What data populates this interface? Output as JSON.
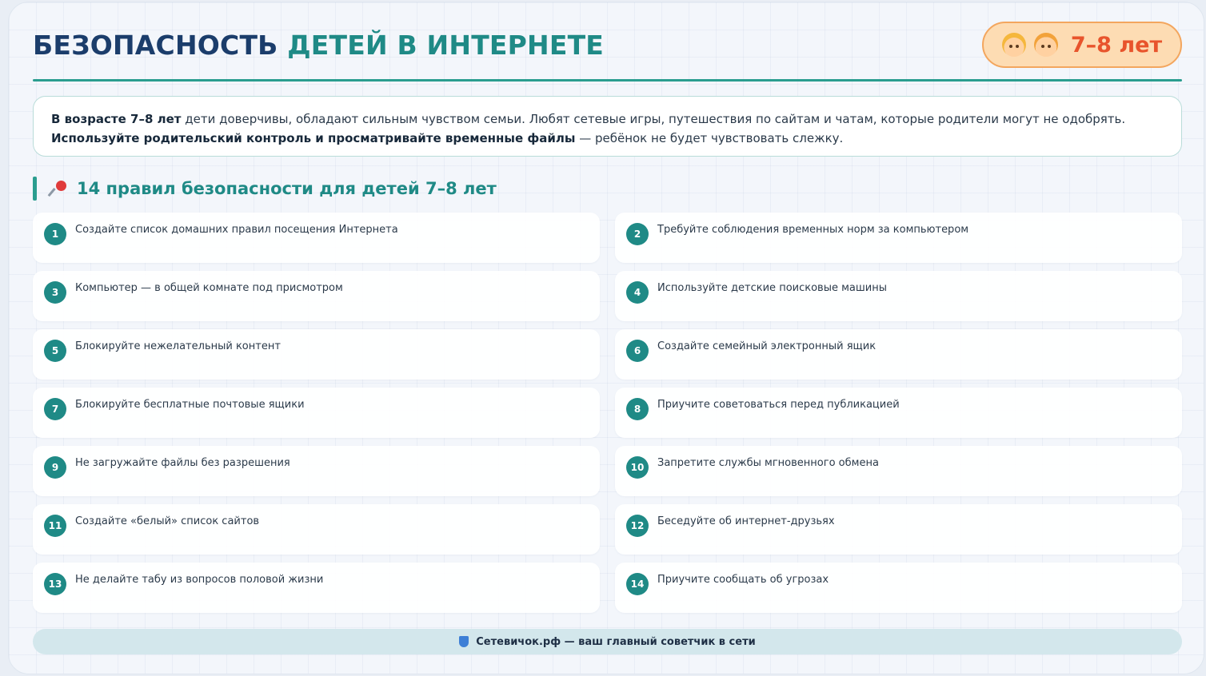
{
  "header": {
    "title_main": "БЕЗОПАСНОСТЬ ",
    "title_accent": "ДЕТЕЙ В ИНТЕРНЕТЕ",
    "age_badge": "7–8 лет",
    "emoji_icons": [
      "girl-face-icon",
      "boy-face-icon"
    ]
  },
  "intro": {
    "bold_start": "В возрасте 7–8 лет",
    "text": " дети доверчивы, обладают сильным чувством семьи. Любят сетевые игры, путешествия по сайтам и чатам, которые родители могут не одобрять. ",
    "bold_tip": "Используйте родительский контроль и просматривайте временные файлы",
    "text_end": " — ребёнок не будет чувствовать слежку."
  },
  "section": {
    "title": "14 правил безопасности для детей 7–8 лет",
    "icon": "pushpin-icon"
  },
  "rules": [
    {
      "num": "1",
      "text": "Создайте список домашних правил посещения Интернета"
    },
    {
      "num": "2",
      "text": "Требуйте соблюдения временных норм за компьютером"
    },
    {
      "num": "3",
      "text": "Компьютер — в общей комнате под присмотром"
    },
    {
      "num": "4",
      "text": "Используйте детские поисковые машины"
    },
    {
      "num": "5",
      "text": "Блокируйте нежелательный контент"
    },
    {
      "num": "6",
      "text": "Создайте семейный электронный ящик"
    },
    {
      "num": "7",
      "text": "Блокируйте бесплатные почтовые ящики"
    },
    {
      "num": "8",
      "text": "Приучите советоваться перед публикацией"
    },
    {
      "num": "9",
      "text": "Не загружайте файлы без разрешения"
    },
    {
      "num": "10",
      "text": "Запретите службы мгновенного обмена"
    },
    {
      "num": "11",
      "text": "Создайте «белый» список сайтов"
    },
    {
      "num": "12",
      "text": "Беседуйте об интернет-друзьях"
    },
    {
      "num": "13",
      "text": "Не делайте табу из вопросов половой жизни"
    },
    {
      "num": "14",
      "text": "Приучите сообщать об угрозах"
    }
  ],
  "footer": {
    "text": "Сетевичок.рф — ваш главный советчик в сети",
    "icon": "shield-icon"
  },
  "colors": {
    "accent": "#1f8a86",
    "title_dark": "#1b3d6b",
    "badge_bg": "#fddcb3",
    "badge_text": "#e8542c"
  }
}
